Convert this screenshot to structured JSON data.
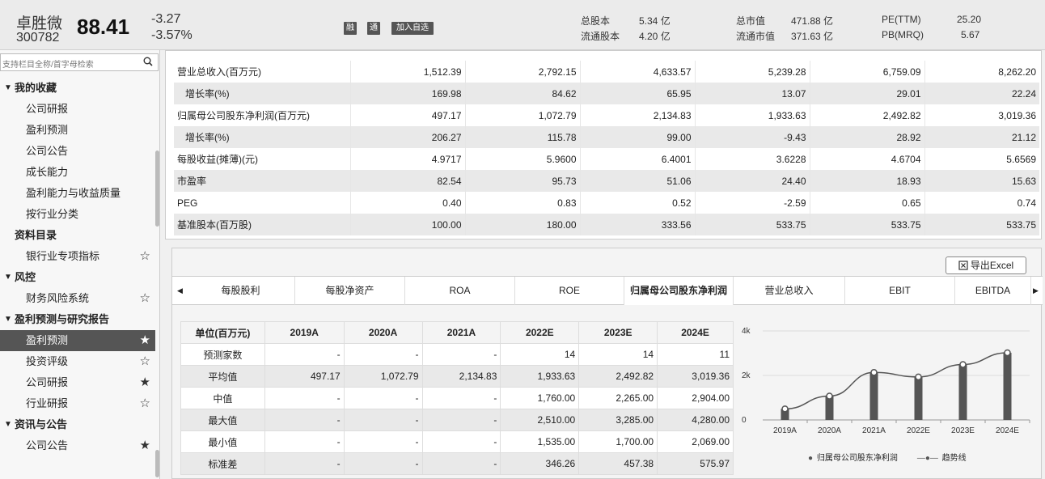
{
  "header": {
    "stock_name": "卓胜微",
    "stock_code": "300782",
    "price": "88.41",
    "change_abs": "-3.27",
    "change_pct": "-3.57%",
    "btn_rong": "融",
    "btn_tong": "通",
    "btn_add": "加入自选",
    "total_shares_label": "总股本",
    "total_shares_value": "5.34 亿",
    "float_shares_label": "流通股本",
    "float_shares_value": "4.20 亿",
    "total_mv_label": "总市值",
    "total_mv_value": "471.88 亿",
    "float_mv_label": "流通市值",
    "float_mv_value": "371.63 亿",
    "pe_label": "PE(TTM)",
    "pe_value": "25.20",
    "pb_label": "PB(MRQ)",
    "pb_value": "5.67"
  },
  "sidebar": {
    "search_placeholder": "支持栏目全称/首字母检索",
    "rows": [
      {
        "label": "我的收藏",
        "group": true
      },
      {
        "label": "公司研报"
      },
      {
        "label": "盈利预测"
      },
      {
        "label": "公司公告"
      },
      {
        "label": "成长能力"
      },
      {
        "label": "盈利能力与收益质量"
      },
      {
        "label": "按行业分类"
      },
      {
        "label": "资料目录",
        "group": true,
        "no_tri": true
      },
      {
        "label": "银行业专项指标",
        "star": "☆"
      },
      {
        "label": "风控",
        "group": true
      },
      {
        "label": "财务风险系统",
        "star": "☆"
      },
      {
        "label": "盈利预测与研究报告",
        "group": true
      },
      {
        "label": "盈利预测",
        "star": "★",
        "active": true
      },
      {
        "label": "投资评级",
        "star": "☆"
      },
      {
        "label": "公司研报",
        "star": "★"
      },
      {
        "label": "行业研报",
        "star": "☆"
      },
      {
        "label": "资讯与公告",
        "group": true
      },
      {
        "label": "公司公告",
        "star": "★"
      }
    ]
  },
  "top_table": {
    "rows": [
      {
        "label": "营业总收入(百万元)",
        "indent": false,
        "values": [
          "1,512.39",
          "2,792.15",
          "4,633.57",
          "5,239.28",
          "6,759.09",
          "8,262.20"
        ]
      },
      {
        "label": "增长率(%)",
        "indent": true,
        "values": [
          "169.98",
          "84.62",
          "65.95",
          "13.07",
          "29.01",
          "22.24"
        ]
      },
      {
        "label": "归属母公司股东净利润(百万元)",
        "indent": false,
        "values": [
          "497.17",
          "1,072.79",
          "2,134.83",
          "1,933.63",
          "2,492.82",
          "3,019.36"
        ]
      },
      {
        "label": "增长率(%)",
        "indent": true,
        "values": [
          "206.27",
          "115.78",
          "99.00",
          "-9.43",
          "28.92",
          "21.12"
        ]
      },
      {
        "label": "每股收益(摊薄)(元)",
        "indent": false,
        "values": [
          "4.9717",
          "5.9600",
          "6.4001",
          "3.6228",
          "4.6704",
          "5.6569"
        ]
      },
      {
        "label": "市盈率",
        "indent": false,
        "values": [
          "82.54",
          "95.73",
          "51.06",
          "24.40",
          "18.93",
          "15.63"
        ]
      },
      {
        "label": "PEG",
        "indent": false,
        "values": [
          "0.40",
          "0.83",
          "0.52",
          "-2.59",
          "0.65",
          "0.74"
        ]
      },
      {
        "label": "基准股本(百万股)",
        "indent": false,
        "values": [
          "100.00",
          "180.00",
          "333.56",
          "533.75",
          "533.75",
          "533.75"
        ]
      }
    ]
  },
  "lower": {
    "export_label": "导出Excel",
    "tabs": [
      "每股股利",
      "每股净资产",
      "ROA",
      "ROE",
      "归属母公司股东净利润",
      "营业总收入",
      "EBIT",
      "EBITDA"
    ],
    "active_tab": 4,
    "table": {
      "headers": [
        "单位(百万元)",
        "2019A",
        "2020A",
        "2021A",
        "2022E",
        "2023E",
        "2024E"
      ],
      "rows": [
        {
          "label": "预测家数",
          "values": [
            "-",
            "-",
            "-",
            "14",
            "14",
            "11"
          ]
        },
        {
          "label": "平均值",
          "values": [
            "497.17",
            "1,072.79",
            "2,134.83",
            "1,933.63",
            "2,492.82",
            "3,019.36"
          ]
        },
        {
          "label": "中值",
          "values": [
            "-",
            "-",
            "-",
            "1,760.00",
            "2,265.00",
            "2,904.00"
          ]
        },
        {
          "label": "最大值",
          "values": [
            "-",
            "-",
            "-",
            "2,510.00",
            "3,285.00",
            "4,280.00"
          ]
        },
        {
          "label": "最小值",
          "values": [
            "-",
            "-",
            "-",
            "1,535.00",
            "1,700.00",
            "2,069.00"
          ]
        },
        {
          "label": "标准差",
          "values": [
            "-",
            "-",
            "-",
            "346.26",
            "457.38",
            "575.97"
          ]
        }
      ]
    }
  },
  "chart_data": {
    "type": "bar",
    "categories": [
      "2019A",
      "2020A",
      "2021A",
      "2022E",
      "2023E",
      "2024E"
    ],
    "series": [
      {
        "name": "归属母公司股东净利润",
        "values": [
          497.17,
          1072.79,
          2134.83,
          1933.63,
          2492.82,
          3019.36
        ],
        "color": "#555555"
      },
      {
        "name": "趋势线",
        "values": [
          497.17,
          1072.79,
          2134.83,
          1933.63,
          2492.82,
          3019.36
        ],
        "color": "#555555",
        "kind": "line"
      }
    ],
    "yticks": [
      "0",
      "2k",
      "4k"
    ],
    "ylim": [
      0,
      4000
    ],
    "grid": true,
    "legend_position": "bottom"
  }
}
